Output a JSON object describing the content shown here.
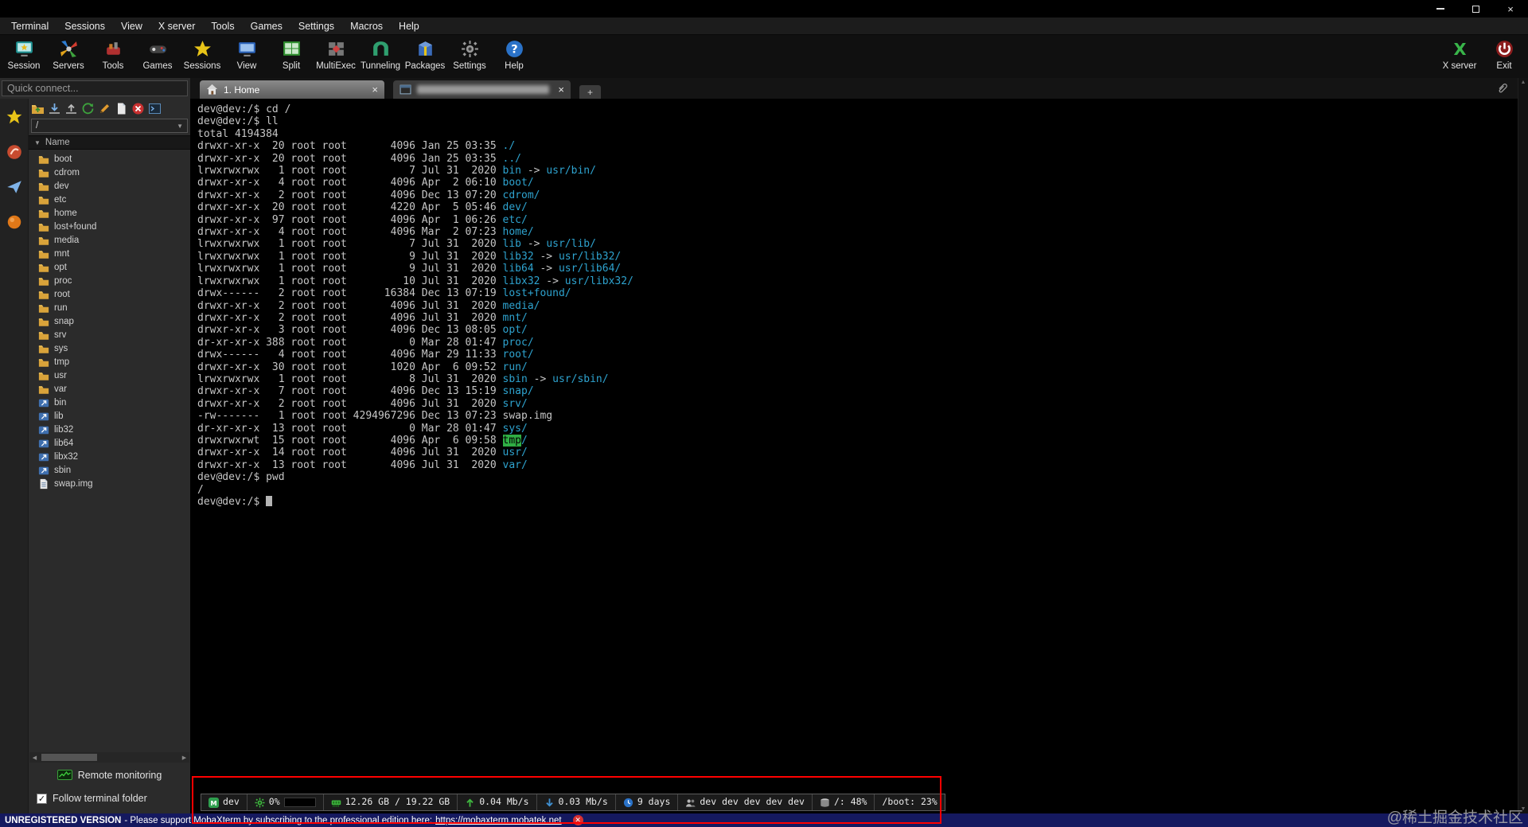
{
  "menu": {
    "items": [
      "Terminal",
      "Sessions",
      "View",
      "X server",
      "Tools",
      "Games",
      "Settings",
      "Macros",
      "Help"
    ]
  },
  "toolbar": {
    "items": [
      {
        "label": "Session",
        "icon": "session"
      },
      {
        "label": "Servers",
        "icon": "servers"
      },
      {
        "label": "Tools",
        "icon": "tools"
      },
      {
        "label": "Games",
        "icon": "games"
      },
      {
        "label": "Sessions",
        "icon": "sessions"
      },
      {
        "label": "View",
        "icon": "view"
      },
      {
        "label": "Split",
        "icon": "split"
      },
      {
        "label": "MultiExec",
        "icon": "multiexec"
      },
      {
        "label": "Tunneling",
        "icon": "tunneling"
      },
      {
        "label": "Packages",
        "icon": "packages"
      },
      {
        "label": "Settings",
        "icon": "settings"
      },
      {
        "label": "Help",
        "icon": "help"
      }
    ],
    "right_items": [
      {
        "label": "X server",
        "icon": "xserver"
      },
      {
        "label": "Exit",
        "icon": "exit"
      }
    ]
  },
  "sidebar": {
    "quick_connect": "Quick connect...",
    "strip_icons": [
      "star",
      "sftp",
      "macros",
      "ball"
    ],
    "file_toolbar_icons": [
      "ft-folder-upload",
      "ft-download",
      "ft-upload",
      "ft-refresh",
      "ft-edit",
      "ft-new",
      "ft-stop",
      "ft-console"
    ],
    "path_value": "/",
    "tree_header": "Name",
    "tree_items": [
      {
        "label": "boot",
        "type": "folder"
      },
      {
        "label": "cdrom",
        "type": "folder"
      },
      {
        "label": "dev",
        "type": "folder"
      },
      {
        "label": "etc",
        "type": "folder"
      },
      {
        "label": "home",
        "type": "folder"
      },
      {
        "label": "lost+found",
        "type": "folder"
      },
      {
        "label": "media",
        "type": "folder"
      },
      {
        "label": "mnt",
        "type": "folder"
      },
      {
        "label": "opt",
        "type": "folder"
      },
      {
        "label": "proc",
        "type": "folder"
      },
      {
        "label": "root",
        "type": "folder"
      },
      {
        "label": "run",
        "type": "folder"
      },
      {
        "label": "snap",
        "type": "folder"
      },
      {
        "label": "srv",
        "type": "folder"
      },
      {
        "label": "sys",
        "type": "folder"
      },
      {
        "label": "tmp",
        "type": "folder"
      },
      {
        "label": "usr",
        "type": "folder"
      },
      {
        "label": "var",
        "type": "folder"
      },
      {
        "label": "bin",
        "type": "link"
      },
      {
        "label": "lib",
        "type": "link"
      },
      {
        "label": "lib32",
        "type": "link"
      },
      {
        "label": "lib64",
        "type": "link"
      },
      {
        "label": "libx32",
        "type": "link"
      },
      {
        "label": "sbin",
        "type": "link"
      },
      {
        "label": "swap.img",
        "type": "file"
      }
    ],
    "remote_monitoring": "Remote monitoring",
    "follow_terminal_folder": "Follow terminal folder"
  },
  "tabs": {
    "items": [
      {
        "label": "1. Home",
        "active": true,
        "redacted": false,
        "icon": "home"
      },
      {
        "label": "",
        "active": false,
        "redacted": true,
        "icon": "console-tab"
      }
    ],
    "new_tab_label": "+"
  },
  "terminal": {
    "lines": [
      [
        {
          "t": "dev@dev:/$ cd /"
        }
      ],
      [
        {
          "t": "dev@dev:/$ ll"
        }
      ],
      [
        {
          "t": "total 4194384"
        }
      ],
      [
        {
          "t": "drwxr-xr-x  20 root root       4096 Jan 25 03:35 "
        },
        {
          "t": "./",
          "s": "dir"
        }
      ],
      [
        {
          "t": "drwxr-xr-x  20 root root       4096 Jan 25 03:35 "
        },
        {
          "t": "../",
          "s": "dir"
        }
      ],
      [
        {
          "t": "lrwxrwxrwx   1 root root          7 Jul 31  2020 "
        },
        {
          "t": "bin",
          "s": "dir"
        },
        {
          "t": " -> "
        },
        {
          "t": "usr/bin/",
          "s": "dir"
        }
      ],
      [
        {
          "t": "drwxr-xr-x   4 root root       4096 Apr  2 06:10 "
        },
        {
          "t": "boot/",
          "s": "dir"
        }
      ],
      [
        {
          "t": "drwxr-xr-x   2 root root       4096 Dec 13 07:20 "
        },
        {
          "t": "cdrom/",
          "s": "dir"
        }
      ],
      [
        {
          "t": "drwxr-xr-x  20 root root       4220 Apr  5 05:46 "
        },
        {
          "t": "dev/",
          "s": "dir"
        }
      ],
      [
        {
          "t": "drwxr-xr-x  97 root root       4096 Apr  1 06:26 "
        },
        {
          "t": "etc/",
          "s": "dir"
        }
      ],
      [
        {
          "t": "drwxr-xr-x   4 root root       4096 Mar  2 07:23 "
        },
        {
          "t": "home/",
          "s": "dir"
        }
      ],
      [
        {
          "t": "lrwxrwxrwx   1 root root          7 Jul 31  2020 "
        },
        {
          "t": "lib",
          "s": "dir"
        },
        {
          "t": " -> "
        },
        {
          "t": "usr/lib/",
          "s": "dir"
        }
      ],
      [
        {
          "t": "lrwxrwxrwx   1 root root          9 Jul 31  2020 "
        },
        {
          "t": "lib32",
          "s": "dir"
        },
        {
          "t": " -> "
        },
        {
          "t": "usr/lib32/",
          "s": "dir"
        }
      ],
      [
        {
          "t": "lrwxrwxrwx   1 root root          9 Jul 31  2020 "
        },
        {
          "t": "lib64",
          "s": "dir"
        },
        {
          "t": " -> "
        },
        {
          "t": "usr/lib64/",
          "s": "dir"
        }
      ],
      [
        {
          "t": "lrwxrwxrwx   1 root root         10 Jul 31  2020 "
        },
        {
          "t": "libx32",
          "s": "dir"
        },
        {
          "t": " -> "
        },
        {
          "t": "usr/libx32/",
          "s": "dir"
        }
      ],
      [
        {
          "t": "drwx------   2 root root      16384 Dec 13 07:19 "
        },
        {
          "t": "lost+found/",
          "s": "dir"
        }
      ],
      [
        {
          "t": "drwxr-xr-x   2 root root       4096 Jul 31  2020 "
        },
        {
          "t": "media/",
          "s": "dir"
        }
      ],
      [
        {
          "t": "drwxr-xr-x   2 root root       4096 Jul 31  2020 "
        },
        {
          "t": "mnt/",
          "s": "dir"
        }
      ],
      [
        {
          "t": "drwxr-xr-x   3 root root       4096 Dec 13 08:05 "
        },
        {
          "t": "opt/",
          "s": "dir"
        }
      ],
      [
        {
          "t": "dr-xr-xr-x 388 root root          0 Mar 28 01:47 "
        },
        {
          "t": "proc/",
          "s": "dir"
        }
      ],
      [
        {
          "t": "drwx------   4 root root       4096 Mar 29 11:33 "
        },
        {
          "t": "root/",
          "s": "dir"
        }
      ],
      [
        {
          "t": "drwxr-xr-x  30 root root       1020 Apr  6 09:52 "
        },
        {
          "t": "run/",
          "s": "dir"
        }
      ],
      [
        {
          "t": "lrwxrwxrwx   1 root root          8 Jul 31  2020 "
        },
        {
          "t": "sbin",
          "s": "dir"
        },
        {
          "t": " -> "
        },
        {
          "t": "usr/sbin/",
          "s": "dir"
        }
      ],
      [
        {
          "t": "drwxr-xr-x   7 root root       4096 Dec 13 15:19 "
        },
        {
          "t": "snap/",
          "s": "dir"
        }
      ],
      [
        {
          "t": "drwxr-xr-x   2 root root       4096 Jul 31  2020 "
        },
        {
          "t": "srv/",
          "s": "dir"
        }
      ],
      [
        {
          "t": "-rw-------   1 root root 4294967296 Dec 13 07:23 swap.img"
        }
      ],
      [
        {
          "t": "dr-xr-xr-x  13 root root          0 Mar 28 01:47 "
        },
        {
          "t": "sys/",
          "s": "dir"
        }
      ],
      [
        {
          "t": "drwxrwxrwt  15 root root       4096 Apr  6 09:58 "
        },
        {
          "t": "tmp",
          "s": "tmp"
        },
        {
          "t": "/",
          "s": "dir"
        }
      ],
      [
        {
          "t": "drwxr-xr-x  14 root root       4096 Jul 31  2020 "
        },
        {
          "t": "usr/",
          "s": "dir"
        }
      ],
      [
        {
          "t": "drwxr-xr-x  13 root root       4096 Jul 31  2020 "
        },
        {
          "t": "var/",
          "s": "dir"
        }
      ],
      [
        {
          "t": "dev@dev:/$ pwd"
        }
      ],
      [
        {
          "t": "/"
        }
      ],
      [
        {
          "t": "dev@dev:/$ "
        },
        {
          "cursor": true
        }
      ]
    ]
  },
  "monitor_bar": {
    "segments": [
      {
        "name": "host",
        "icon": "app",
        "text": "dev"
      },
      {
        "name": "cpu",
        "icon": "cpu",
        "text": "0%",
        "gauge": true
      },
      {
        "name": "ram",
        "icon": "ram",
        "text": "12.26 GB / 19.22 GB"
      },
      {
        "name": "upload",
        "icon": "up",
        "text": "0.04 Mb/s"
      },
      {
        "name": "download",
        "icon": "down",
        "text": "0.03 Mb/s"
      },
      {
        "name": "uptime",
        "icon": "clock",
        "text": "9 days"
      },
      {
        "name": "users",
        "icon": "users",
        "text": "dev dev dev dev dev"
      },
      {
        "name": "disk-root",
        "icon": "disk",
        "text": "/: 48%"
      },
      {
        "name": "disk-boot",
        "icon": null,
        "text": "/boot: 23%"
      }
    ]
  },
  "status_bar": {
    "bold": "UNREGISTERED VERSION",
    "text": "- Please support MobaXterm by subscribing to the professional edition here: ",
    "link": "https://mobaxterm.mobatek.net"
  },
  "watermark": "@稀土掘金技术社区"
}
